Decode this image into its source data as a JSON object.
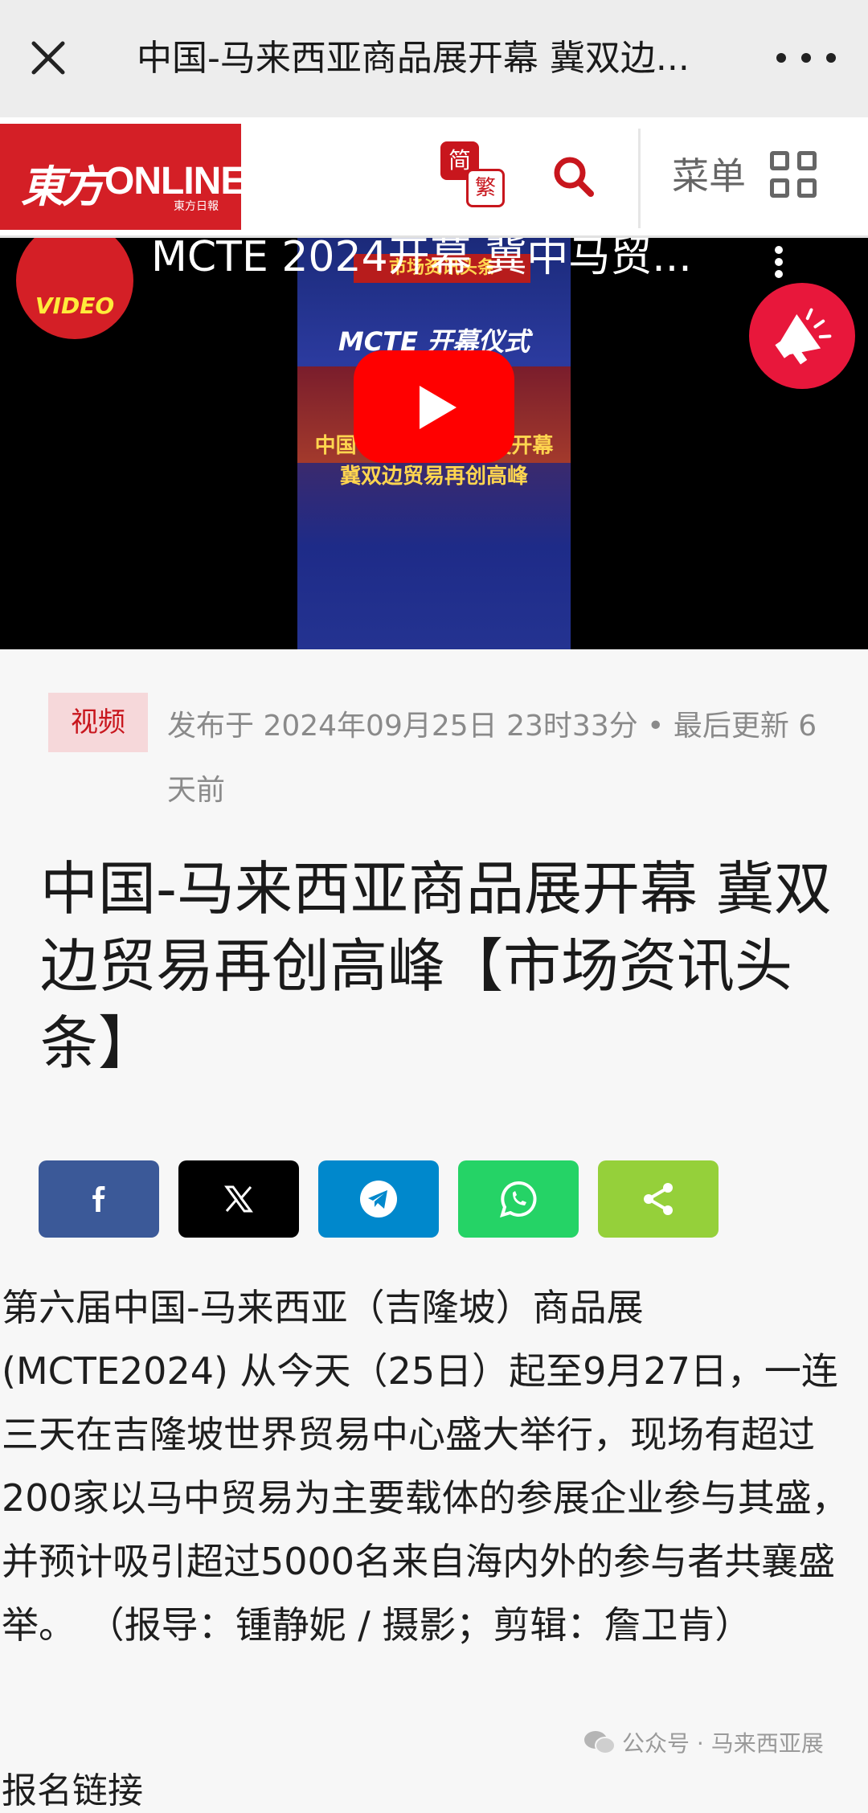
{
  "wechat": {
    "title": "中国-马来西亚商品展开幕 冀双边...",
    "close_icon": "close-icon",
    "more_icon": "more-dots-icon"
  },
  "site": {
    "logo_mark": "東方",
    "logo_online": "ONLINE",
    "logo_sub": "東方日報",
    "lang_simplified": "简",
    "lang_traditional": "繁",
    "menu_label": "菜单"
  },
  "video": {
    "channel_label": "VIDEO",
    "title": "MCTE 2024开幕 冀中马贸...",
    "thumb_banner": "市场资讯头条",
    "thumb_heading": "MCTE 开幕仪式",
    "thumb_caption1": "中国-马来西亚商品展开幕",
    "thumb_caption2": "冀双边贸易再创高峰"
  },
  "article": {
    "category": "视频",
    "meta": "发布于 2024年09月25日 23时33分 • 最后更新 6天前",
    "headline": "中国-马来西亚商品展开幕 冀双边贸易再创高峰【市场资讯头条】",
    "body": "第六届中国-马来西亚（吉隆坡）商品展(MCTE2024) 从今天（25日）起至9月27日，一连三天在吉隆坡世界贸易中心盛大举行，现场有超过200家以马中贸易为主要载体的参展企业参与其盛，并预计吸引超过5000名来自海内外的参与者共襄盛举。 （报导：锺静妮 / 摄影；剪辑：詹卫肯）",
    "related": "报名链接"
  },
  "share": [
    {
      "name": "facebook",
      "color": "#3b5998"
    },
    {
      "name": "x",
      "color": "#000000"
    },
    {
      "name": "telegram",
      "color": "#0088cc"
    },
    {
      "name": "whatsapp",
      "color": "#25d366"
    },
    {
      "name": "share",
      "color": "#95d03a"
    }
  ],
  "watermark": "公众号 · 马来西亚展"
}
